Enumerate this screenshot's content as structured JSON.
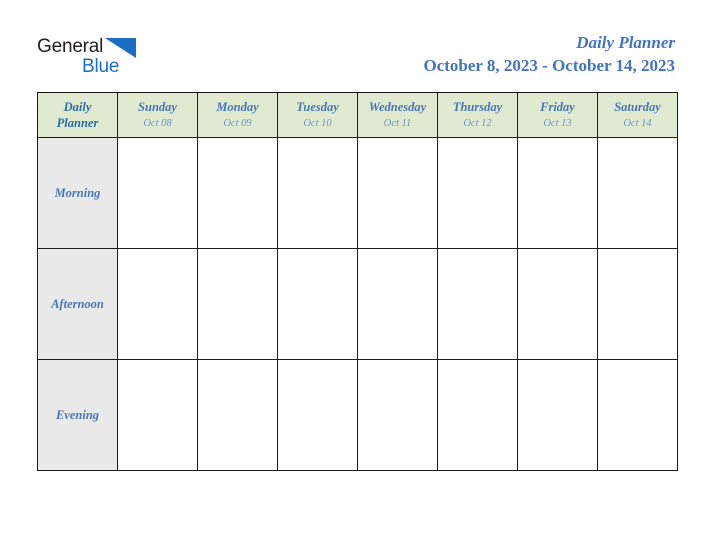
{
  "brand": {
    "name_dark": "General",
    "name_blue": "Blue",
    "triangle_icon": "triangle-icon",
    "dark_color": "#231f20",
    "blue_color": "#1b6ec2"
  },
  "header": {
    "title": "Daily Planner",
    "date_range": "October 8, 2023 - October 14, 2023",
    "title_color": "#4472c4"
  },
  "table": {
    "corner": {
      "line1": "Daily",
      "line2": "Planner"
    },
    "header_bg": "#dfead0",
    "row_label_bg": "#e9e9e9",
    "cell_bg": "#fefefe",
    "border_color": "#1a1a1a",
    "columns": [
      {
        "day": "Sunday",
        "date": "Oct 08"
      },
      {
        "day": "Monday",
        "date": "Oct 09"
      },
      {
        "day": "Tuesday",
        "date": "Oct 10"
      },
      {
        "day": "Wednesday",
        "date": "Oct 11"
      },
      {
        "day": "Thursday",
        "date": "Oct 12"
      },
      {
        "day": "Friday",
        "date": "Oct 13"
      },
      {
        "day": "Saturday",
        "date": "Oct 14"
      }
    ],
    "rows": [
      {
        "label": "Morning"
      },
      {
        "label": "Afternoon"
      },
      {
        "label": "Evening"
      }
    ]
  }
}
